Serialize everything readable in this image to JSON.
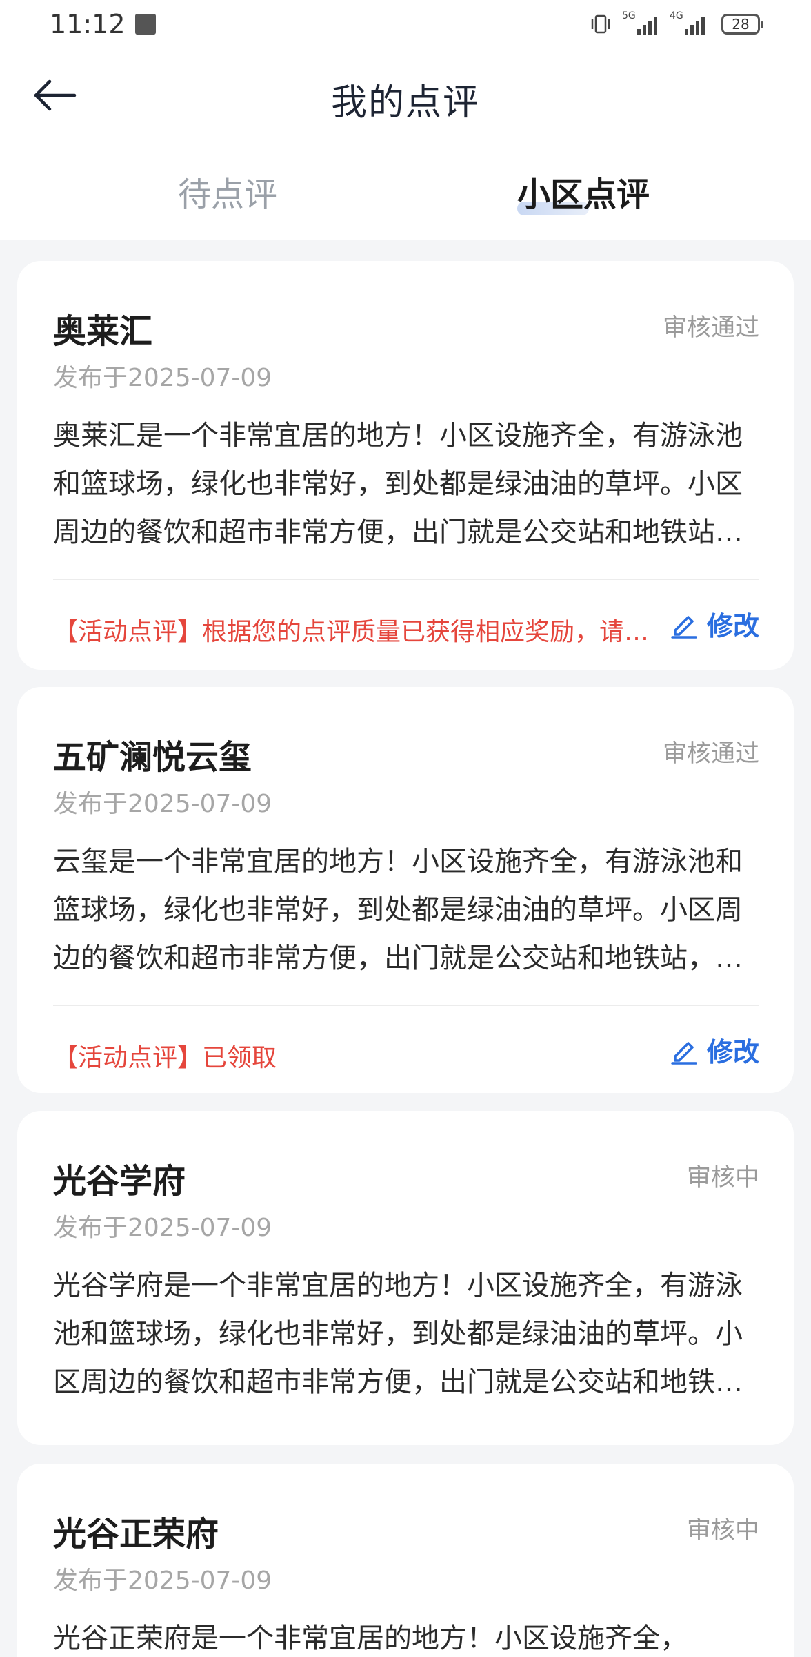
{
  "status_bar": {
    "time": "11:12",
    "signal1_label": "5G",
    "signal2_label": "4G",
    "battery": "28"
  },
  "header": {
    "title": "我的点评"
  },
  "tabs": [
    {
      "label": "待点评",
      "active": false
    },
    {
      "label": "小区点评",
      "active": true
    }
  ],
  "accent_color": "#2a6ee0",
  "activity_color": "#e5463c",
  "reviews": [
    {
      "name": "奥莱汇",
      "status": "审核通过",
      "date": "发布于2025-07-09",
      "text": "奥莱汇是一个非常宜居的地方！小区设施齐全，有游泳池和篮球场，绿化也非常好，到处都是绿油油的草坪。小区周边的餐饮和超市非常方便，出门就是公交站和地铁站，交通非常便利。",
      "activity": "【活动点评】根据您的点评质量已获得相应奖励，请前往查看",
      "edit_label": "修改"
    },
    {
      "name": "五矿澜悦云玺",
      "status": "审核通过",
      "date": "发布于2025-07-09",
      "text": "云玺是一个非常宜居的地方！小区设施齐全，有游泳池和篮球场，绿化也非常好，到处都是绿油油的草坪。小区周边的餐饮和超市非常方便，出门就是公交站和地铁站，交通非常便利。",
      "activity": "【活动点评】已领取",
      "edit_label": "修改"
    },
    {
      "name": "光谷学府",
      "status": "审核中",
      "date": "发布于2025-07-09",
      "text": "光谷学府是一个非常宜居的地方！小区设施齐全，有游泳池和篮球场，绿化也非常好，到处都是绿油油的草坪。小区周边的餐饮和超市非常方便，出门就是公交站和地铁站，交通非常便利。"
    },
    {
      "name": "光谷正荣府",
      "status": "审核中",
      "date": "发布于2025-07-09",
      "text": "光谷正荣府是一个非常宜居的地方！小区设施齐全，"
    }
  ]
}
